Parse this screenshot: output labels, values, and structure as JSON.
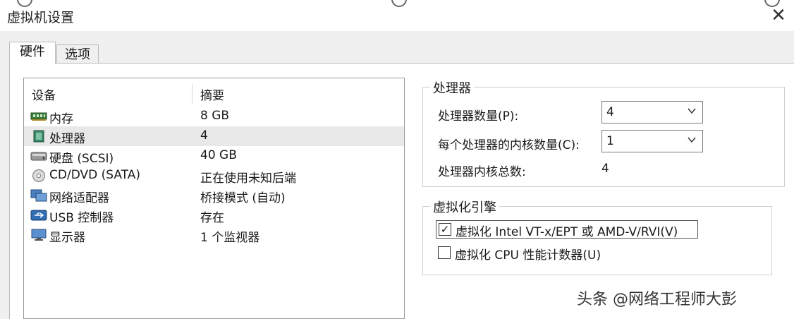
{
  "window": {
    "title": "虚拟机设置",
    "close_glyph": "✕"
  },
  "tabs": [
    {
      "label": "硬件",
      "active": true
    },
    {
      "label": "选项",
      "active": false
    }
  ],
  "device_list": {
    "header": {
      "device": "设备",
      "summary": "摘要"
    },
    "rows": [
      {
        "name": "内存",
        "summary": "8 GB",
        "icon": "memory-icon",
        "selected": false
      },
      {
        "name": "处理器",
        "summary": "4",
        "icon": "processor-icon",
        "selected": true
      },
      {
        "name": "硬盘 (SCSI)",
        "summary": "40 GB",
        "icon": "hard-disk-icon",
        "selected": false
      },
      {
        "name": "CD/DVD (SATA)",
        "summary": "正在使用未知后端",
        "icon": "cd-dvd-icon",
        "selected": false
      },
      {
        "name": "网络适配器",
        "summary": "桥接模式 (自动)",
        "icon": "network-adapter-icon",
        "selected": false
      },
      {
        "name": "USB 控制器",
        "summary": "存在",
        "icon": "usb-icon",
        "selected": false
      },
      {
        "name": "显示器",
        "summary": "1 个监视器",
        "icon": "display-icon",
        "selected": false
      }
    ]
  },
  "processor_group": {
    "legend": "处理器",
    "processor_count_label": "处理器数量(P):",
    "processor_count_value": "4",
    "cores_per_processor_label": "每个处理器的内核数量(C):",
    "cores_per_processor_value": "1",
    "total_cores_label": "处理器内核总数:",
    "total_cores_value": "4"
  },
  "virtualization_group": {
    "legend": "虚拟化引擎",
    "options": [
      {
        "label": "虚拟化 Intel VT-x/EPT 或 AMD-V/RVI(V)",
        "checked": true,
        "check_glyph": "✓"
      },
      {
        "label": "虚拟化 CPU 性能计数器(U)",
        "checked": false,
        "check_glyph": ""
      }
    ]
  },
  "watermark": {
    "text": "头条 @网络工程师大彭"
  }
}
